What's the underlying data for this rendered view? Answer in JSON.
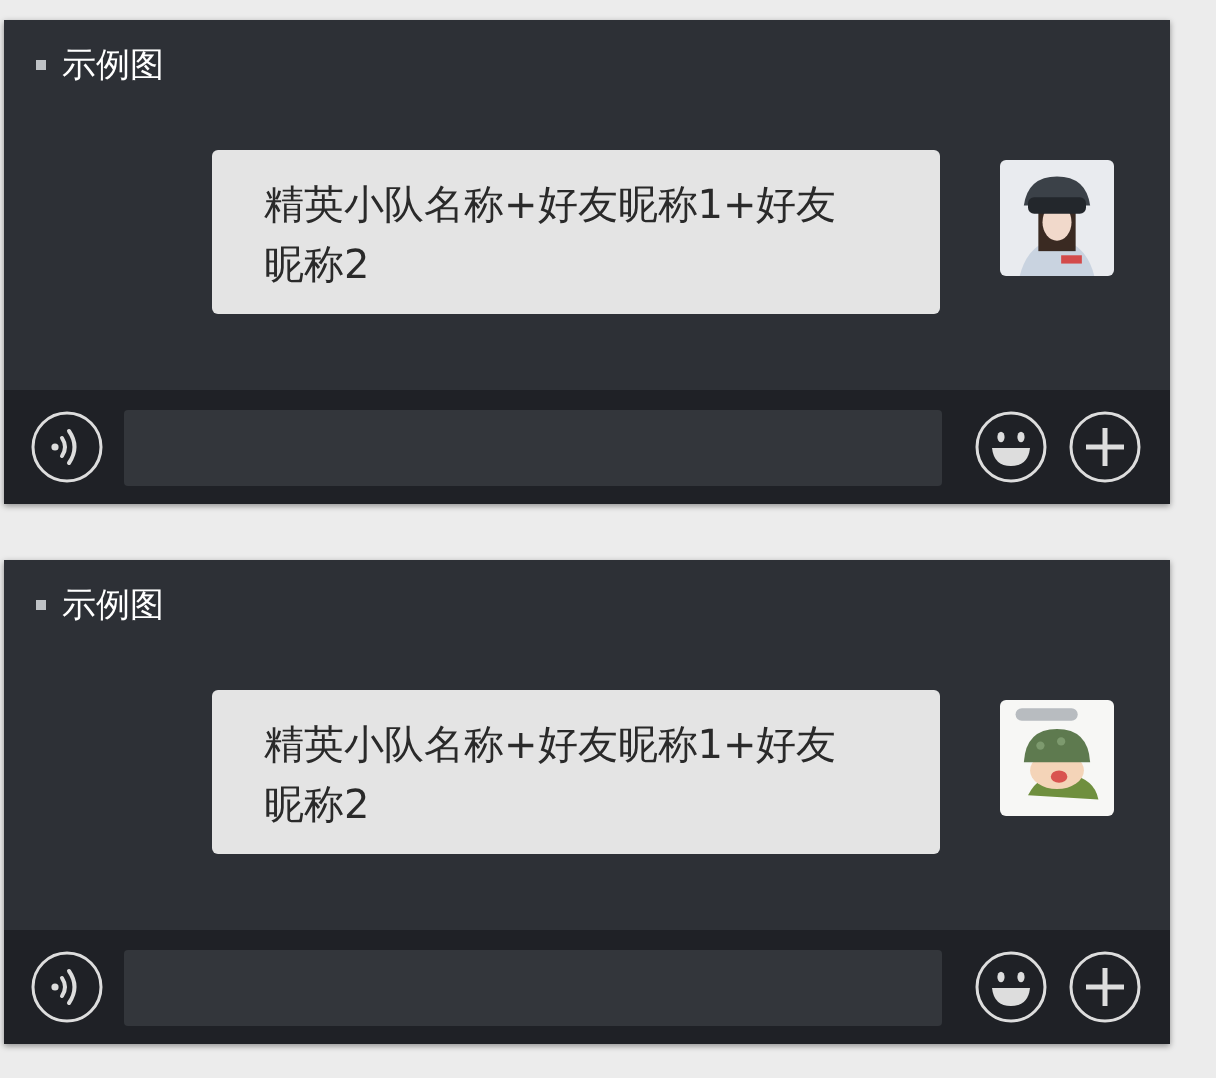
{
  "panels": [
    {
      "title": "示例图",
      "message": "精英小队名称+好友昵称1+好友昵称2"
    },
    {
      "title": "示例图",
      "message": "精英小队名称+好友昵称1+好友昵称2"
    }
  ]
}
